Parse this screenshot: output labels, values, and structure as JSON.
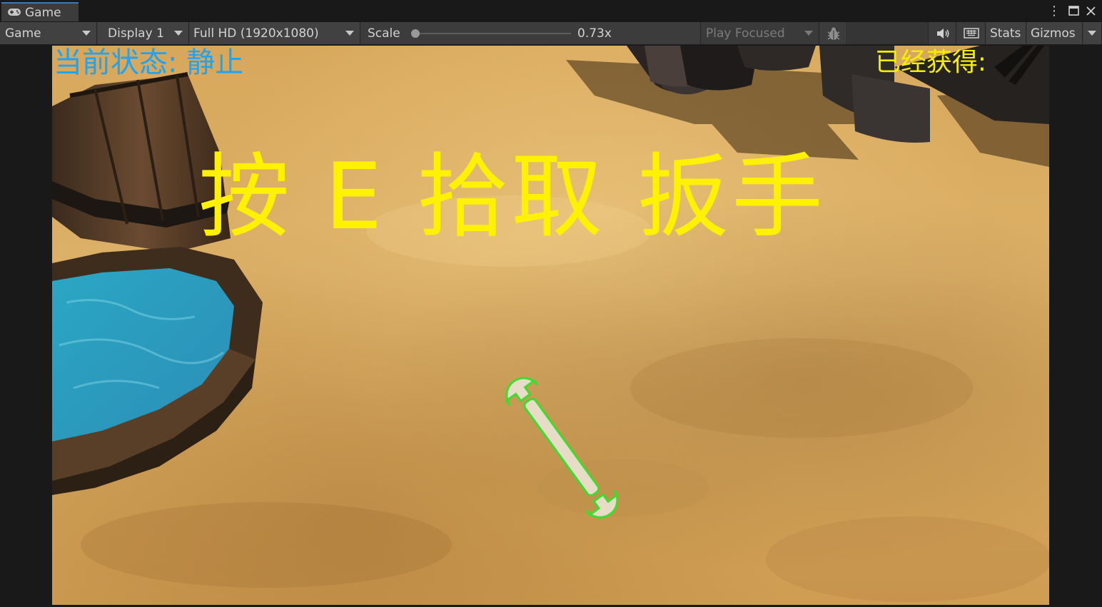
{
  "tab": {
    "title": "Game",
    "icon": "gamepad-icon"
  },
  "window_controls": {
    "more": "⋮",
    "maximize": "🗖",
    "close": "✕"
  },
  "toolbar": {
    "mode": "Game",
    "display": "Display 1",
    "resolution": "Full HD (1920x1080)",
    "scale_label": "Scale",
    "scale_value": "0.73x",
    "scale_level": 0.0,
    "play_mode": "Play Focused",
    "stats": "Stats",
    "gizmos": "Gizmos",
    "icons": [
      "bug-icon",
      "audio-icon",
      "keyboard-icon"
    ]
  },
  "hud": {
    "state": "当前状态: 静止",
    "obtained": "已经获得:",
    "prompt": "按 E 拾取 扳手"
  },
  "colors": {
    "state_text": "#1ea3f5",
    "prompt_text": "#fff200",
    "obtained_text": "#f6ee00",
    "wrench_outline": "#3ddc2f",
    "ground": "#d7a85c"
  }
}
